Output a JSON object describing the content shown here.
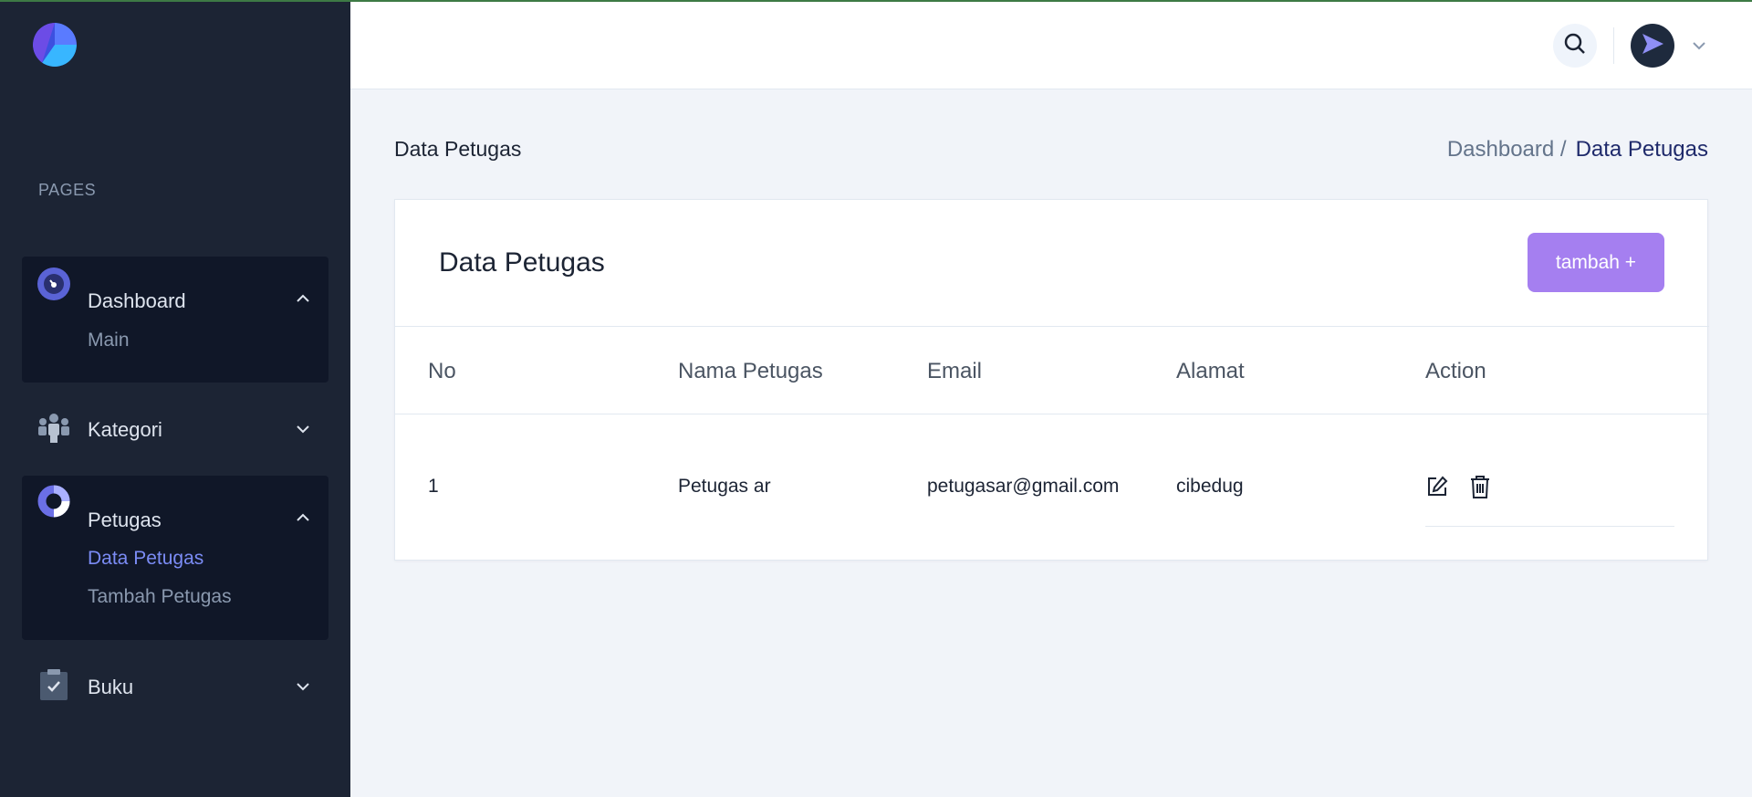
{
  "sidebar": {
    "section_label": "PAGES",
    "groups": [
      {
        "label": "Dashboard",
        "icon": "dashboard-gauge-icon",
        "expanded": true,
        "items": [
          {
            "label": "Main",
            "active": false
          }
        ]
      },
      {
        "label": "Kategori",
        "icon": "people-icon",
        "expanded": false,
        "items": []
      },
      {
        "label": "Petugas",
        "icon": "donut-chart-icon",
        "expanded": true,
        "items": [
          {
            "label": "Data Petugas",
            "active": true
          },
          {
            "label": "Tambah Petugas",
            "active": false
          }
        ]
      },
      {
        "label": "Buku",
        "icon": "clipboard-check-icon",
        "expanded": false,
        "items": []
      }
    ]
  },
  "header": {
    "search_icon": "search-icon",
    "avatar_icon": "send-icon"
  },
  "page": {
    "title": "Data Petugas",
    "breadcrumb": {
      "parent": "Dashboard /",
      "current": "Data Petugas"
    }
  },
  "card": {
    "title": "Data Petugas",
    "add_button": "tambah +",
    "columns": [
      "No",
      "Nama Petugas",
      "Email",
      "Alamat",
      "Action"
    ],
    "rows": [
      {
        "no": "1",
        "nama": "Petugas ar",
        "email": "petugasar@gmail.com",
        "alamat": "cibedug"
      }
    ]
  },
  "colors": {
    "sidebar": "#1c2434",
    "sidebar_active": "#101728",
    "accent": "#a57ff0",
    "active_link": "#7b8cf5"
  }
}
